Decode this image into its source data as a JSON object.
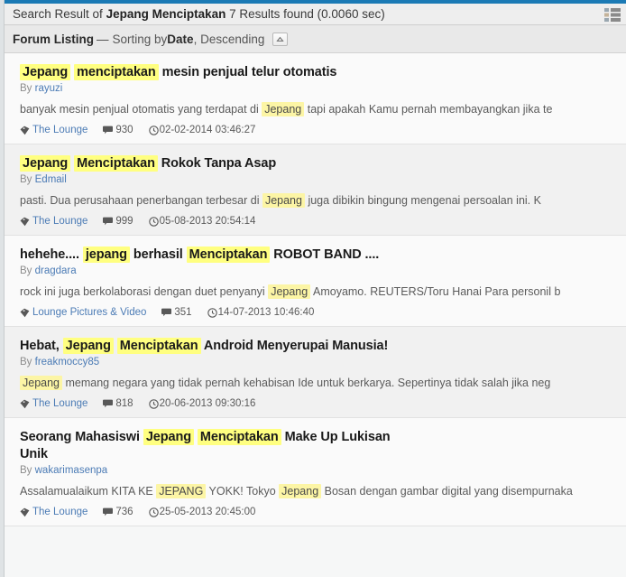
{
  "theme": {
    "accent_bar": "#1b7ab5",
    "link": "#4b7bb5",
    "title_highlight": "#ffff80",
    "snippet_highlight": "#fcf5a5"
  },
  "header": {
    "prefix": "Search Result of ",
    "query": "Jepang Menciptakan",
    "suffix": " 7 Results found (0.0060 sec)",
    "view_icon": "list-view-icon"
  },
  "listing_bar": {
    "label": "Forum Listing",
    "dash": "—",
    "sorting_prefix": "Sorting by ",
    "sort_field": "Date",
    "sort_direction": ", Descending",
    "toggle_icon": "chevron-up-icon"
  },
  "results": [
    {
      "title_parts": [
        {
          "text": "Jepang",
          "mark": true
        },
        {
          "text": " ",
          "mark": false
        },
        {
          "text": "menciptakan",
          "mark": true
        },
        {
          "text": " mesin penjual telur otomatis",
          "mark": false
        }
      ],
      "by_label": "By ",
      "author": "rayuzi",
      "snippet_parts": [
        {
          "text": "banyak mesin penjual otomatis yang terdapat di ",
          "mark": false
        },
        {
          "text": "Jepang",
          "mark": true
        },
        {
          "text": " tapi apakah Kamu pernah membayangkan jika te",
          "mark": false
        }
      ],
      "forum": "The Lounge",
      "replies": "930",
      "date": "02-02-2014 03:46:27"
    },
    {
      "title_parts": [
        {
          "text": "Jepang",
          "mark": true
        },
        {
          "text": " ",
          "mark": false
        },
        {
          "text": "Menciptakan",
          "mark": true
        },
        {
          "text": " Rokok Tanpa Asap",
          "mark": false
        }
      ],
      "by_label": "By ",
      "author": "Edmail",
      "snippet_parts": [
        {
          "text": "pasti. Dua perusahaan penerbangan terbesar di ",
          "mark": false
        },
        {
          "text": "Jepang",
          "mark": true
        },
        {
          "text": " juga dibikin bingung mengenai persoalan ini. K",
          "mark": false
        }
      ],
      "forum": "The Lounge",
      "replies": "999",
      "date": "05-08-2013 20:54:14"
    },
    {
      "title_parts": [
        {
          "text": "hehehe.... ",
          "mark": false
        },
        {
          "text": "jepang",
          "mark": true
        },
        {
          "text": " berhasil ",
          "mark": false
        },
        {
          "text": "Menciptakan",
          "mark": true
        },
        {
          "text": " ROBOT BAND ....",
          "mark": false
        }
      ],
      "by_label": "By ",
      "author": "dragdara",
      "snippet_parts": [
        {
          "text": "rock ini juga berkolaborasi dengan duet penyanyi ",
          "mark": false
        },
        {
          "text": "Jepang",
          "mark": true
        },
        {
          "text": " Amoyamo. REUTERS/Toru Hanai Para personil b",
          "mark": false
        }
      ],
      "forum": "Lounge Pictures & Video",
      "replies": "351",
      "date": "14-07-2013 10:46:40"
    },
    {
      "title_parts": [
        {
          "text": "Hebat, ",
          "mark": false
        },
        {
          "text": "Jepang",
          "mark": true
        },
        {
          "text": " ",
          "mark": false
        },
        {
          "text": "Menciptakan",
          "mark": true
        },
        {
          "text": " Android Menyerupai Manusia!",
          "mark": false
        }
      ],
      "by_label": "By ",
      "author": "freakmoccy85",
      "snippet_parts": [
        {
          "text": "Jepang",
          "mark": true
        },
        {
          "text": " memang negara yang tidak pernah kehabisan Ide untuk berkarya. Sepertinya tidak salah jika neg",
          "mark": false
        }
      ],
      "forum": "The Lounge",
      "replies": "818",
      "date": "20-06-2013 09:30:16"
    },
    {
      "title_parts": [
        {
          "text": "Seorang Mahasiswi ",
          "mark": false
        },
        {
          "text": "Jepang",
          "mark": true
        },
        {
          "text": " ",
          "mark": false
        },
        {
          "text": "Menciptakan",
          "mark": true
        },
        {
          "text": " Make Up Lukisan Unik",
          "mark": false
        }
      ],
      "by_label": "By ",
      "author": "wakarimasenpa",
      "snippet_parts": [
        {
          "text": "Assalamualaikum KITA KE ",
          "mark": false
        },
        {
          "text": "JEPANG",
          "mark": true
        },
        {
          "text": " YOKK! Tokyo ",
          "mark": false
        },
        {
          "text": "Jepang",
          "mark": true
        },
        {
          "text": " Bosan dengan gambar digital yang disempurnaka",
          "mark": false
        }
      ],
      "forum": "The Lounge",
      "replies": "736",
      "date": "25-05-2013 20:45:00"
    }
  ],
  "icons": {
    "tag": "tag-icon",
    "comment": "comment-icon",
    "clock": "clock-icon"
  }
}
